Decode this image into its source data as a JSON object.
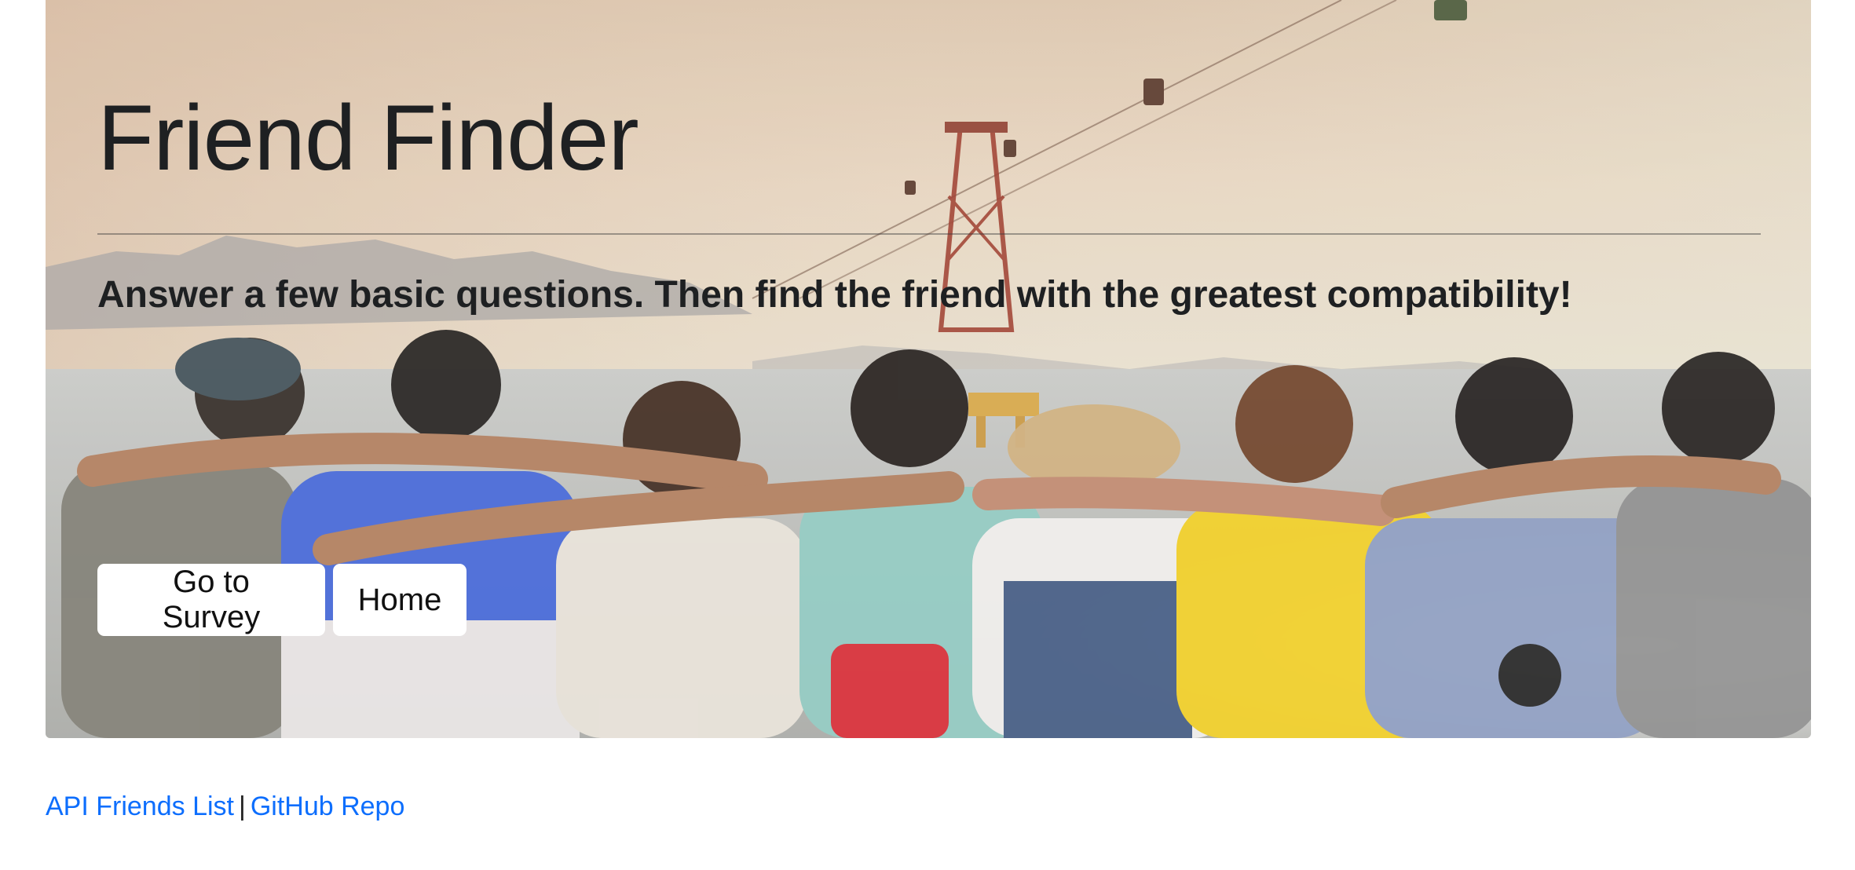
{
  "hero": {
    "title": "Friend Finder",
    "lead": "Answer a few basic questions. Then find the friend with the greatest compatibility!",
    "background_image": "group-of-friends-arms-around-shoulders-sea-cable-car"
  },
  "buttons": {
    "survey_label": "Go to Survey",
    "home_label": "Home"
  },
  "footer": {
    "api_link_label": "API Friends List",
    "separator": "|",
    "github_link_label": "GitHub Repo"
  },
  "colors": {
    "link": "#0d6efd",
    "text": "#212529",
    "button_bg": "#ffffff"
  }
}
